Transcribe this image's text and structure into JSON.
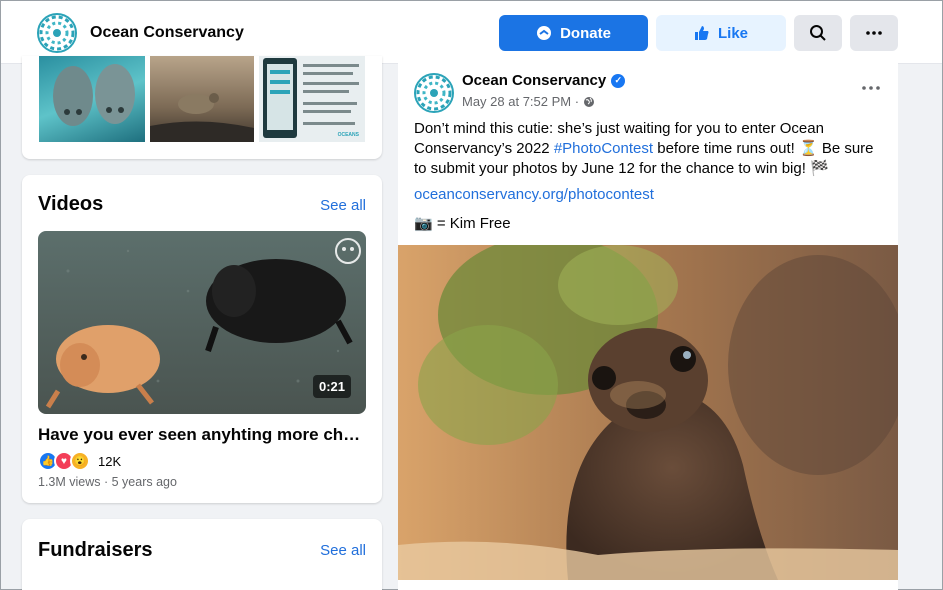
{
  "header": {
    "page_name": "Ocean Conservancy",
    "donate_label": "Donate",
    "like_label": "Like"
  },
  "icons": [
    "ocean-conservancy-logo",
    "donate-icon",
    "thumbs-up-icon",
    "search-icon",
    "more-icon",
    "verified-badge-icon",
    "globe-icon",
    "camera-emoji",
    "hourglass-emoji",
    "flag-emoji"
  ],
  "photos_preview": {
    "thumb3_lines": [
      "neighborhood that are killed by fishing",
      "Have you seen more...",
      "No neighborhood ..."
    ],
    "thumb3_footer": "OCEANS"
  },
  "videos": {
    "title": "Videos",
    "see_all": "See all",
    "duration": "0:21",
    "video_title": "Have you ever seen anyhting more char…",
    "reaction_count": "12K",
    "meta": "1.3M views · 5 years ago"
  },
  "fundraisers": {
    "title": "Fundraisers",
    "see_all": "See all"
  },
  "post": {
    "author": "Ocean Conservancy",
    "date": "May 28 at 7:52 PM ·",
    "text_1": "Don’t mind this cutie: she’s just waiting for you to enter Ocean Conservancy’s 2022 ",
    "hashtag": "#PhotoContest",
    "text_2": " before time runs out! ⏳ Be sure to submit your photos by June 12 for the chance to win big! 🏁",
    "link": "oceanconservancy.org/photocontest",
    "credit": "📷 = Kim Free"
  },
  "colors": {
    "brand_blue": "#1b74e4",
    "like_bg": "#e7f3ff",
    "link": "#216fdb",
    "logo_teal": "#2ba3b8"
  }
}
